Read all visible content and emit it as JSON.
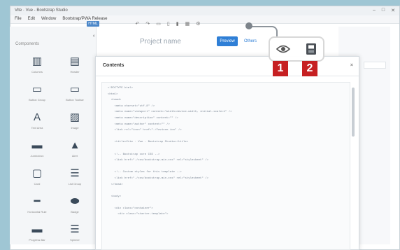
{
  "window": {
    "title": "Vite · Vue - Bootstrap Studio",
    "menu": [
      "File",
      "Edit",
      "Window",
      "Bootstrap/PWA Release"
    ],
    "controls": [
      "–",
      "□",
      "✕"
    ]
  },
  "toolbar": {
    "tag": "HTML",
    "icons": [
      "undo-icon",
      "redo-icon",
      "desktop-icon",
      "tablet-icon",
      "phone-icon",
      "grid-icon",
      "settings-icon"
    ]
  },
  "sidebar": {
    "title": "Components",
    "collapse": "‹",
    "items": [
      {
        "icon": "columns-icon",
        "glyph": "▥",
        "label": "Columns"
      },
      {
        "icon": "header-icon",
        "glyph": "▤",
        "label": "Header"
      },
      {
        "icon": "button-group-icon",
        "glyph": "▭",
        "label": "Button Group"
      },
      {
        "icon": "button-toolbar-icon",
        "glyph": "▭",
        "label": "Button Toolbar"
      },
      {
        "icon": "text-icon",
        "glyph": "A",
        "label": "Text Area"
      },
      {
        "icon": "image-icon",
        "glyph": "▨",
        "label": "Image"
      },
      {
        "icon": "jumbotron-icon",
        "glyph": "▬",
        "label": "Jumbotron"
      },
      {
        "icon": "alert-icon",
        "glyph": "▲",
        "label": "Alert"
      },
      {
        "icon": "card-icon",
        "glyph": "▢",
        "label": "Card"
      },
      {
        "icon": "list-group-icon",
        "glyph": "☰",
        "label": "List Group"
      },
      {
        "icon": "horizontal-rule-icon",
        "glyph": "━",
        "label": "Horizontal Rule"
      },
      {
        "icon": "badge-icon",
        "glyph": "⬬",
        "label": "Badge"
      },
      {
        "icon": "progress-bar-icon",
        "glyph": "▬",
        "label": "Progress Bar"
      },
      {
        "icon": "spinner-icon",
        "glyph": "☰",
        "label": "Spinner"
      }
    ]
  },
  "project": {
    "name": "Project name",
    "preview_label": "Preview",
    "other_label": "Others"
  },
  "panel": {
    "title": "Contents",
    "close": "×",
    "code": "<!DOCTYPE html>\n<html>\n  <head>\n    <meta charset=\"utf-8\" />\n    <meta name=\"viewport\" content=\"width=device-width, initial-scale=1\" />\n    <meta name=\"description\" content=\"\" />\n    <meta name=\"author\" content=\"\" />\n    <link rel=\"icon\" href=\"./favicon.ico\" />\n\n    <title>Vite · Vue - Bootstrap Studio</title>\n\n    <!-- Bootstrap core CSS -->\n    <link href=\"./css/bootstrap.min.css\" rel=\"stylesheet\" />\n\n    <!-- Custom styles for this template -->\n    <link href=\"./css/bootstrap.min.css\" rel=\"stylesheet\" />\n  </head>\n\n  <body>\n\n    <div class=\"container\">\n      <div class=\"starter-template\">"
  },
  "callout": {
    "buttons": [
      {
        "icon": "eye-icon",
        "badge": "1"
      },
      {
        "icon": "export-icon",
        "badge": "2"
      }
    ]
  },
  "colors": {
    "accent": "#2f7fd6",
    "badge": "#c62022",
    "background": "#9fc6d4"
  }
}
